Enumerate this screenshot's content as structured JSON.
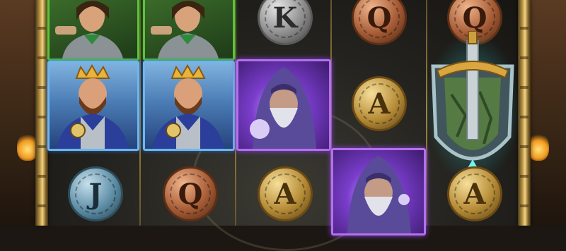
{
  "game": {
    "reels": [
      {
        "symbols": [
          {
            "type": "card",
            "name": "ranger",
            "color": "#5ec23d"
          },
          {
            "type": "card",
            "name": "king",
            "color": "#6fb6ef"
          },
          {
            "type": "coin",
            "letter": "J",
            "metal": "blue-silver"
          }
        ]
      },
      {
        "symbols": [
          {
            "type": "card",
            "name": "ranger",
            "color": "#5ec23d"
          },
          {
            "type": "card",
            "name": "king",
            "color": "#6fb6ef"
          },
          {
            "type": "coin",
            "letter": "Q",
            "metal": "bronze"
          }
        ]
      },
      {
        "symbols": [
          {
            "type": "coin",
            "letter": "K",
            "metal": "silver"
          },
          {
            "type": "card",
            "name": "wizard",
            "color": "#b56ff0"
          },
          {
            "type": "coin",
            "letter": "A",
            "metal": "gold"
          }
        ]
      },
      {
        "symbols": [
          {
            "type": "coin",
            "letter": "Q",
            "metal": "bronze"
          },
          {
            "type": "coin",
            "letter": "A",
            "metal": "gold"
          },
          {
            "type": "card",
            "name": "wizard",
            "color": "#b56ff0"
          }
        ]
      },
      {
        "symbols": [
          {
            "type": "coin",
            "letter": "Q",
            "metal": "bronze"
          },
          {
            "type": "wild",
            "name": "sword-shield",
            "color": "#4fe3e8"
          },
          {
            "type": "coin",
            "letter": "A",
            "metal": "gold"
          }
        ]
      }
    ]
  },
  "coins": {
    "j": "J",
    "q1": "Q",
    "k": "K",
    "a1": "A",
    "q2": "Q",
    "a2": "A",
    "q3": "Q",
    "a3": "A"
  }
}
